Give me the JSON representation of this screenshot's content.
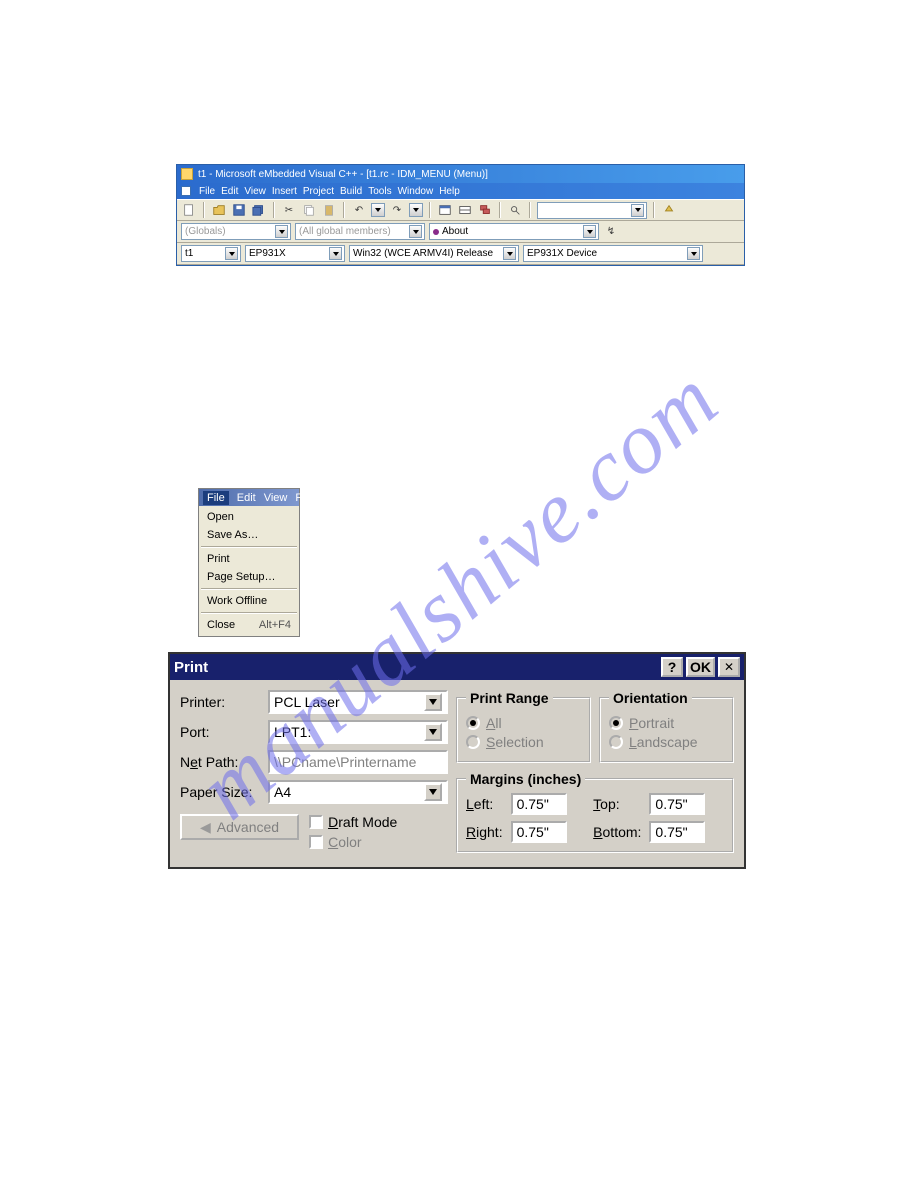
{
  "watermark": "manualshive.com",
  "ide": {
    "title": "t1 - Microsoft eMbedded Visual C++ - [t1.rc - IDM_MENU (Menu)]",
    "menubar": [
      "File",
      "Edit",
      "View",
      "Insert",
      "Project",
      "Build",
      "Tools",
      "Window",
      "Help"
    ],
    "row2": {
      "globals": "(Globals)",
      "members": "(All global members)",
      "about": "About"
    },
    "row3": {
      "project": "t1",
      "platform": "EP931X",
      "config": "Win32 (WCE ARMV4I) Release",
      "device": "EP931X Device"
    }
  },
  "pocket_menu": {
    "bar": [
      "File",
      "Edit",
      "View",
      "Fav"
    ],
    "items": {
      "open": "Open",
      "save_as": "Save As…",
      "print": "Print",
      "page_setup": "Page Setup…",
      "work_offline": "Work Offline",
      "close": "Close",
      "close_accel": "Alt+F4"
    }
  },
  "print": {
    "title": "Print",
    "help": "?",
    "ok": "OK",
    "labels": {
      "printer": "Printer:",
      "port": "Port:",
      "net_path_pre": "N",
      "net_path_u": "e",
      "net_path_post": "t Path:",
      "paper_size": "Paper Size:",
      "advanced": "Advanced",
      "draft_mode_u": "D",
      "draft_mode_post": "raft Mode",
      "color_u": "C",
      "color_post": "olor",
      "print_range": "Print Range",
      "all_u": "A",
      "all_post": "ll",
      "selection_u": "S",
      "selection_post": "election",
      "orientation": "Orientation",
      "portrait_u": "P",
      "portrait_post": "ortrait",
      "landscape_u": "L",
      "landscape_post": "andscape",
      "margins": "Margins (inches)",
      "left_u": "L",
      "left_post": "eft:",
      "right_u": "R",
      "right_post": "ight:",
      "top_u": "T",
      "top_post": "op:",
      "bottom_u": "B",
      "bottom_post": "ottom:"
    },
    "values": {
      "printer": "PCL Laser",
      "port": "LPT1:",
      "net_path": "\\\\PCname\\Printername",
      "paper_size": "A4",
      "left": "0.75\"",
      "right": "0.75\"",
      "top": "0.75\"",
      "bottom": "0.75\""
    }
  }
}
